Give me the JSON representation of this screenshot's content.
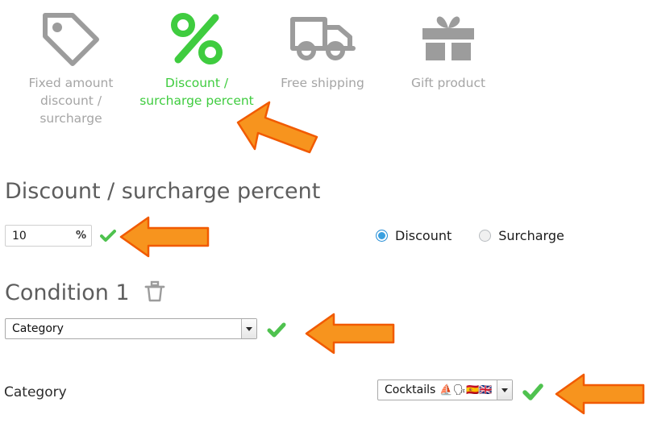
{
  "promotion_types": [
    {
      "id": "fixed-amount",
      "label": "Fixed amount discount / surcharge",
      "icon": "price-tag-icon",
      "active": false
    },
    {
      "id": "discount-percent",
      "label": "Discount / surcharge percent",
      "icon": "percent-icon",
      "active": true
    },
    {
      "id": "free-shipping",
      "label": "Free shipping",
      "icon": "delivery-truck-icon",
      "active": false
    },
    {
      "id": "gift-product",
      "label": "Gift product",
      "icon": "gift-box-icon",
      "active": false
    }
  ],
  "discount_section": {
    "heading": "Discount / surcharge percent",
    "amount_value": "10",
    "amount_placeholder": "10",
    "unit_symbol": "%",
    "valid_mark": "✔",
    "mode_options": [
      {
        "label": "Discount",
        "selected": true
      },
      {
        "label": "Surcharge",
        "selected": false
      }
    ]
  },
  "condition_section": {
    "heading": "Condition 1",
    "delete_icon": "trash-icon",
    "type_select": {
      "value": "Category",
      "options": [
        "Category"
      ]
    },
    "valid_mark": "✔",
    "field_label": "Category",
    "value_select": {
      "value": "Cocktails",
      "emoji": "⛵🗣🇪🇸🇬🇧",
      "options": [
        "Cocktails"
      ]
    },
    "value_valid_mark": "✔"
  },
  "colors": {
    "active_green": "#3fcc3f",
    "inactive_grey": "#a5a5a5",
    "check_green": "#4fc24f",
    "arrow_orange": "#f7941e",
    "arrow_outline": "#f05a00",
    "radio_blue": "#3aa0e0",
    "heading_grey": "#5d5d5d"
  },
  "annotations": [
    {
      "name": "arrow-to-discount-percent-tab",
      "direction": "up-left"
    },
    {
      "name": "arrow-to-percent-input",
      "direction": "left"
    },
    {
      "name": "arrow-to-condition-type-select",
      "direction": "left"
    },
    {
      "name": "arrow-to-category-value-select",
      "direction": "left"
    }
  ]
}
